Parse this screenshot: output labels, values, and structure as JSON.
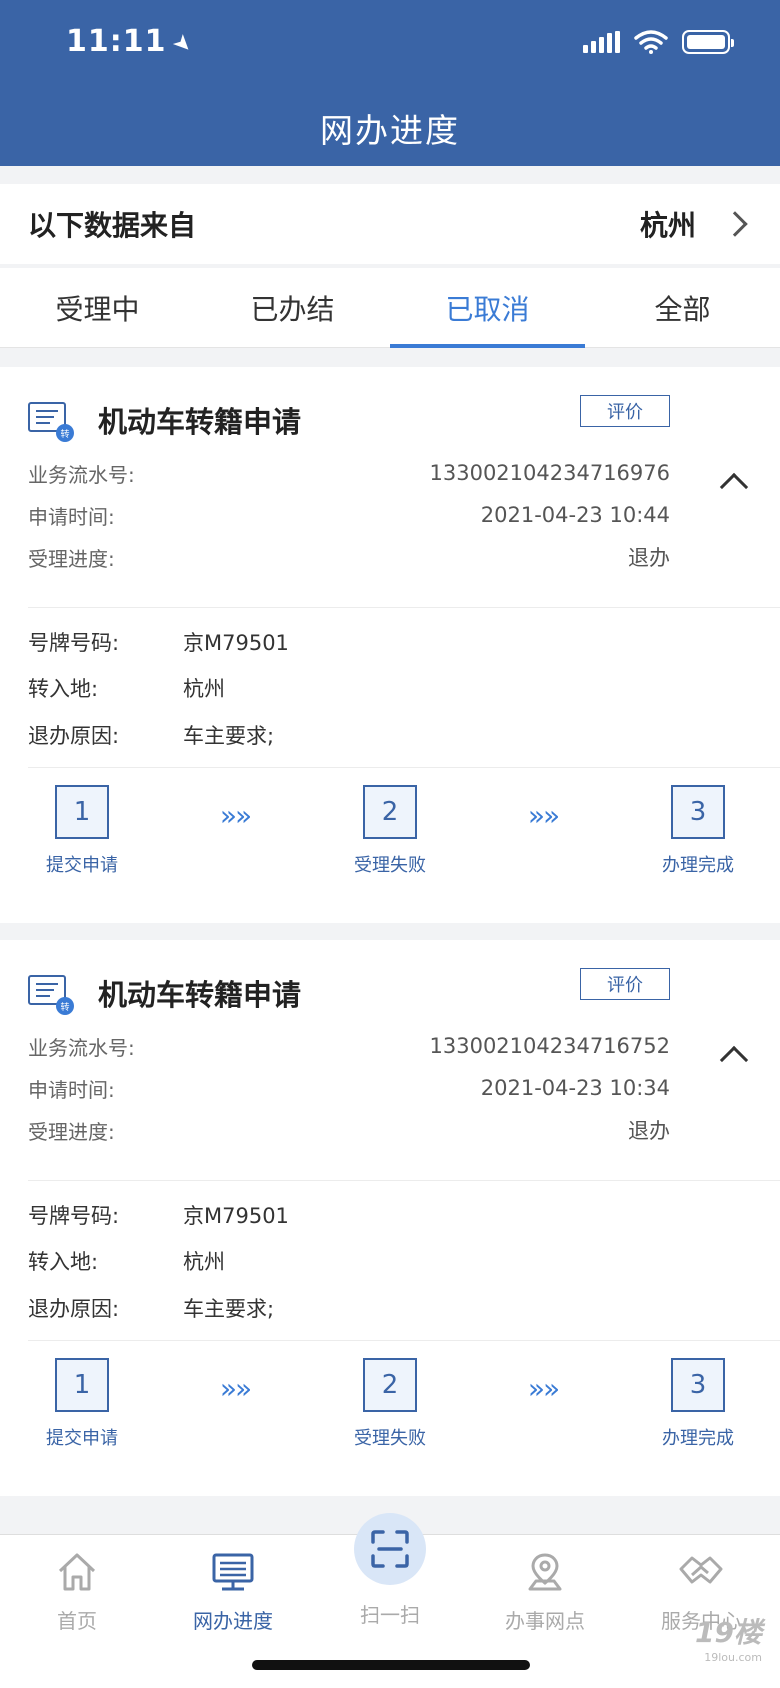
{
  "status": {
    "time": "11:11"
  },
  "header": {
    "title": "网办进度"
  },
  "source": {
    "label": "以下数据来自",
    "city": "杭州"
  },
  "tabs": [
    {
      "label": "受理中"
    },
    {
      "label": "已办结"
    },
    {
      "label": "已取消"
    },
    {
      "label": "全部"
    }
  ],
  "active_tab": "已取消",
  "cards": [
    {
      "icon_badge": "转",
      "title": "机动车转籍申请",
      "eval_label": "评价",
      "serial_label": "业务流水号:",
      "serial": "133002104234716976",
      "time_label": "申请时间:",
      "time": "2021-04-23 10:44",
      "progress_label": "受理进度:",
      "progress": "退办",
      "plate_label": "号牌号码:",
      "plate": "京M79501",
      "dest_label": "转入地:",
      "dest": "杭州",
      "reason_label": "退办原因:",
      "reason": "车主要求;",
      "steps": [
        {
          "num": "1",
          "label": "提交申请"
        },
        {
          "num": "2",
          "label": "受理失败"
        },
        {
          "num": "3",
          "label": "办理完成"
        }
      ]
    },
    {
      "icon_badge": "转",
      "title": "机动车转籍申请",
      "eval_label": "评价",
      "serial_label": "业务流水号:",
      "serial": "133002104234716752",
      "time_label": "申请时间:",
      "time": "2021-04-23 10:34",
      "progress_label": "受理进度:",
      "progress": "退办",
      "plate_label": "号牌号码:",
      "plate": "京M79501",
      "dest_label": "转入地:",
      "dest": "杭州",
      "reason_label": "退办原因:",
      "reason": "车主要求;",
      "steps": [
        {
          "num": "1",
          "label": "提交申请"
        },
        {
          "num": "2",
          "label": "受理失败"
        },
        {
          "num": "3",
          "label": "办理完成"
        }
      ]
    }
  ],
  "step_separator": "»»",
  "tabbar": {
    "home": "首页",
    "progress": "网办进度",
    "scan": "扫一扫",
    "outlets": "办事网点",
    "service": "服务中心"
  },
  "watermark": {
    "main": "19楼",
    "sub": "19lou.com"
  },
  "colors": {
    "primary": "#3a64a6",
    "accent": "#3a7bd5"
  }
}
